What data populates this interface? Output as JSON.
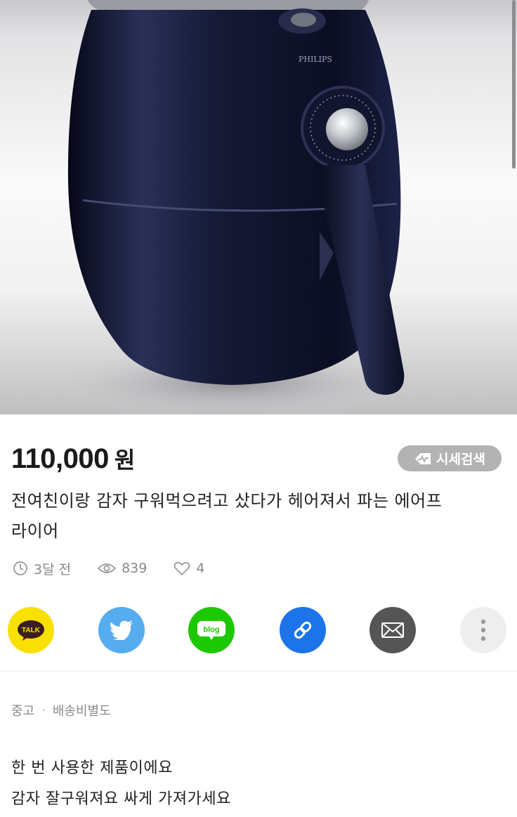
{
  "product_image": {
    "brand_text": "PHILIPS"
  },
  "price": {
    "amount": "110,000",
    "unit": "원"
  },
  "market_search_button": {
    "label": "시세검색"
  },
  "title": {
    "line1": "전여친이랑 감자 구워먹으려고 샀다가 헤어져서 파는 에어프",
    "line2": "라이어"
  },
  "meta": {
    "time": "3달 전",
    "views": "839",
    "likes": "4"
  },
  "share": {
    "kakao_label": "TALK",
    "blog_label": "blog",
    "colors": {
      "kakao": "#f9e000",
      "twitter": "#55acee",
      "blog": "#1ec800",
      "link": "#1c74e8",
      "mail": "#555555",
      "more": "#eeeeee"
    }
  },
  "tags": {
    "condition": "중고",
    "separator": "·",
    "shipping": "배송비별도"
  },
  "description": {
    "line1": "한 번 사용한 제품이에요",
    "line2": "감자 잘구워져요 싸게 가져가세요"
  }
}
